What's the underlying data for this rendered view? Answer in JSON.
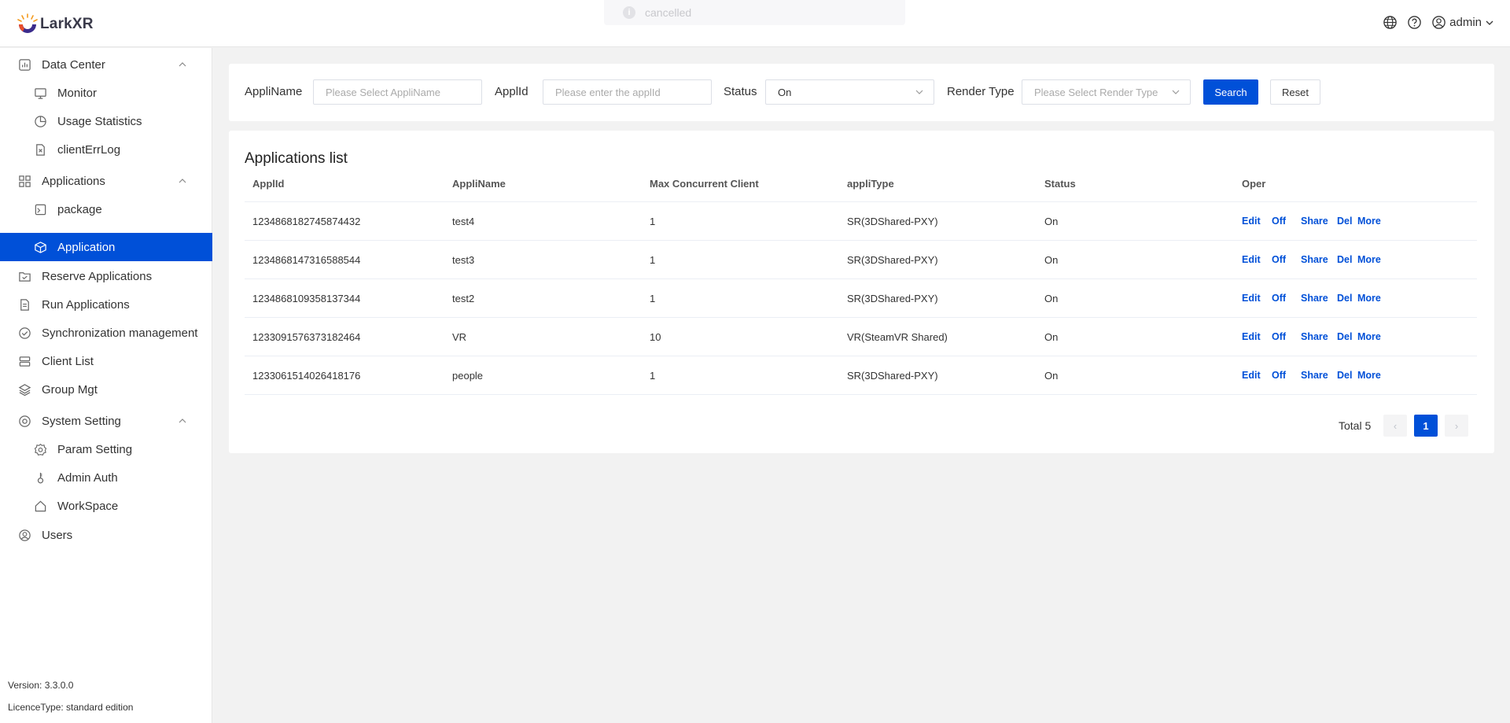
{
  "header": {
    "brand": "LarkXR",
    "toast_text": "cancelled",
    "user_name": "admin"
  },
  "sidebar": {
    "items": [
      {
        "label": "Data Center",
        "icon": "chart-box-icon",
        "level": 0,
        "expanded": true
      },
      {
        "label": "Monitor",
        "icon": "monitor-icon",
        "level": 1
      },
      {
        "label": "Usage Statistics",
        "icon": "pie-chart-icon",
        "level": 1
      },
      {
        "label": "clientErrLog",
        "icon": "error-file-icon",
        "level": 1
      },
      {
        "label": "Applications",
        "icon": "grid-icon",
        "level": 0,
        "expanded": true
      },
      {
        "label": "package",
        "icon": "package-icon",
        "level": 1
      },
      {
        "label": "Application",
        "icon": "cube-icon",
        "level": 1,
        "active": true
      },
      {
        "label": "Reserve Applications",
        "icon": "folder-check-icon",
        "level": 0
      },
      {
        "label": "Run Applications",
        "icon": "document-icon",
        "level": 0
      },
      {
        "label": "Synchronization management",
        "icon": "check-circle-icon",
        "level": 0
      },
      {
        "label": "Client List",
        "icon": "server-icon",
        "level": 0
      },
      {
        "label": "Group Mgt",
        "icon": "layers-icon",
        "level": 0
      },
      {
        "label": "System Setting",
        "icon": "target-icon",
        "level": 0,
        "expanded": true
      },
      {
        "label": "Param Setting",
        "icon": "gear-icon",
        "level": 1
      },
      {
        "label": "Admin Auth",
        "icon": "key-icon",
        "level": 1
      },
      {
        "label": "WorkSpace",
        "icon": "home-icon",
        "level": 1
      },
      {
        "label": "Users",
        "icon": "user-icon",
        "level": 0
      }
    ],
    "version": "Version: 3.3.0.0",
    "licence": "LicenceType: standard edition"
  },
  "filters": {
    "appliname_label": "AppliName",
    "appliname_placeholder": "Please Select AppliName",
    "appliid_label": "ApplId",
    "appliid_placeholder": "Please enter the applId",
    "status_label": "Status",
    "status_value": "On",
    "render_type_label": "Render Type",
    "render_type_placeholder": "Please Select Render Type",
    "search_label": "Search",
    "reset_label": "Reset"
  },
  "list": {
    "title": "Applications list",
    "columns": [
      "ApplId",
      "AppliName",
      "Max Concurrent Client",
      "appliType",
      "Status",
      "Oper"
    ],
    "rows": [
      {
        "id": "1234868182745874432",
        "name": "test4",
        "max": "1",
        "type": "SR(3DShared-PXY)",
        "status": "On"
      },
      {
        "id": "1234868147316588544",
        "name": "test3",
        "max": "1",
        "type": "SR(3DShared-PXY)",
        "status": "On"
      },
      {
        "id": "1234868109358137344",
        "name": "test2",
        "max": "1",
        "type": "SR(3DShared-PXY)",
        "status": "On"
      },
      {
        "id": "1233091576373182464",
        "name": "VR",
        "max": "10",
        "type": "VR(SteamVR Shared)",
        "status": "On"
      },
      {
        "id": "1233061514026418176",
        "name": "people",
        "max": "1",
        "type": "SR(3DShared-PXY)",
        "status": "On"
      }
    ],
    "ops": [
      "Edit",
      "Off",
      "Share",
      "Del",
      "More"
    ],
    "total_text": "Total 5",
    "current_page": "1",
    "prev_glyph": "‹",
    "next_glyph": "›"
  },
  "colors": {
    "accent": "#0050d8",
    "background": "#f2f2f2"
  }
}
